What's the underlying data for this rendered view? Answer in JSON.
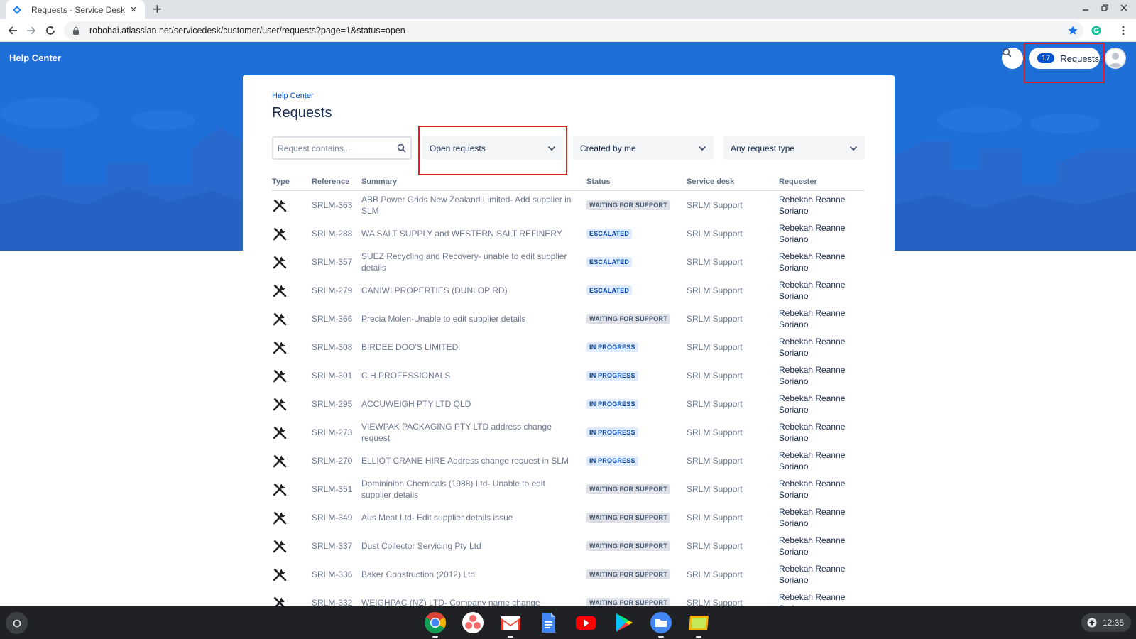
{
  "browser": {
    "tab_title": "Requests - Service Desk",
    "tab_close": "×",
    "new_tab": "+",
    "url_host": "robobai.atlassian.net",
    "url_path": "/servicedesk/customer/user/requests?page=1&status=open"
  },
  "header": {
    "help_center": "Help Center",
    "requests_count": "17",
    "requests_label": "Requests"
  },
  "card": {
    "breadcrumb": "Help Center",
    "title": "Requests"
  },
  "filters": {
    "search_placeholder": "Request contains...",
    "status_filter": "Open requests",
    "owner_filter": "Created by me",
    "type_filter": "Any request type"
  },
  "table": {
    "columns": [
      "Type",
      "Reference",
      "Summary",
      "Status",
      "Service desk",
      "Requester"
    ],
    "rows": [
      {
        "ref": "SRLM-363",
        "summary": "ABB Power Grids New Zealand Limited- Add supplier in SLM",
        "status": "WAITING FOR SUPPORT",
        "desk": "SRLM Support",
        "requester": "Rebekah Reanne Soriano"
      },
      {
        "ref": "SRLM-288",
        "summary": "WA SALT SUPPLY and WESTERN SALT REFINERY",
        "status": "ESCALATED",
        "desk": "SRLM Support",
        "requester": "Rebekah Reanne Soriano"
      },
      {
        "ref": "SRLM-357",
        "summary": "SUEZ Recycling and Recovery- unable to edit supplier details",
        "status": "ESCALATED",
        "desk": "SRLM Support",
        "requester": "Rebekah Reanne Soriano"
      },
      {
        "ref": "SRLM-279",
        "summary": "CANIWI PROPERTIES (DUNLOP RD)",
        "status": "ESCALATED",
        "desk": "SRLM Support",
        "requester": "Rebekah Reanne Soriano"
      },
      {
        "ref": "SRLM-366",
        "summary": "Precia Molen-Unable to edit supplier details",
        "status": "WAITING FOR SUPPORT",
        "desk": "SRLM Support",
        "requester": "Rebekah Reanne Soriano"
      },
      {
        "ref": "SRLM-308",
        "summary": "BIRDEE DOO'S LIMITED",
        "status": "IN PROGRESS",
        "desk": "SRLM Support",
        "requester": "Rebekah Reanne Soriano"
      },
      {
        "ref": "SRLM-301",
        "summary": "C H PROFESSIONALS",
        "status": "IN PROGRESS",
        "desk": "SRLM Support",
        "requester": "Rebekah Reanne Soriano"
      },
      {
        "ref": "SRLM-295",
        "summary": "ACCUWEIGH PTY LTD QLD",
        "status": "IN PROGRESS",
        "desk": "SRLM Support",
        "requester": "Rebekah Reanne Soriano"
      },
      {
        "ref": "SRLM-273",
        "summary": "VIEWPAK PACKAGING PTY LTD address change request",
        "status": "IN PROGRESS",
        "desk": "SRLM Support",
        "requester": "Rebekah Reanne Soriano"
      },
      {
        "ref": "SRLM-270",
        "summary": "ELLIOT CRANE HIRE Address change request in SLM",
        "status": "IN PROGRESS",
        "desk": "SRLM Support",
        "requester": "Rebekah Reanne Soriano"
      },
      {
        "ref": "SRLM-351",
        "summary": "Domininion Chemicals (1988) Ltd- Unable to edit supplier details",
        "status": "WAITING FOR SUPPORT",
        "desk": "SRLM Support",
        "requester": "Rebekah Reanne Soriano"
      },
      {
        "ref": "SRLM-349",
        "summary": "Aus Meat Ltd- Edit supplier details issue",
        "status": "WAITING FOR SUPPORT",
        "desk": "SRLM Support",
        "requester": "Rebekah Reanne Soriano"
      },
      {
        "ref": "SRLM-337",
        "summary": "Dust Collector Servicing Pty Ltd",
        "status": "WAITING FOR SUPPORT",
        "desk": "SRLM Support",
        "requester": "Rebekah Reanne Soriano"
      },
      {
        "ref": "SRLM-336",
        "summary": "Baker Construction (2012) Ltd",
        "status": "WAITING FOR SUPPORT",
        "desk": "SRLM Support",
        "requester": "Rebekah Reanne Soriano"
      },
      {
        "ref": "SRLM-332",
        "summary": "WEIGHPAC (NZ) LTD- Company name change",
        "status": "WAITING FOR SUPPORT",
        "desk": "SRLM Support",
        "requester": "Rebekah Reanne Soriano"
      }
    ]
  },
  "status_colors": {
    "WAITING FOR SUPPORT": {
      "bg": "#dfe1e6",
      "fg": "#42526e"
    },
    "ESCALATED": {
      "bg": "#deebff",
      "fg": "#0747a6"
    },
    "IN PROGRESS": {
      "bg": "#deebff",
      "fg": "#0747a6"
    }
  },
  "taskbar": {
    "apps": [
      "chrome-icon",
      "asana-icon",
      "gmail-icon",
      "docs-icon",
      "youtube-icon",
      "play-store-icon",
      "files-icon",
      "slides-icon"
    ],
    "clock": "12:35"
  },
  "colors": {
    "hero_blue": "#1f6fd8",
    "highlight_red": "#e31c23",
    "link_blue": "#0052cc"
  }
}
